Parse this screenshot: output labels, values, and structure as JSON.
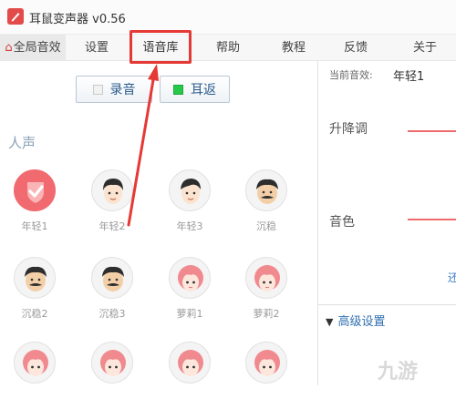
{
  "window": {
    "title": "耳鼠变声器 v0.56"
  },
  "tabs": [
    {
      "label": "全局音效",
      "icon": "lock-icon"
    },
    {
      "label": "设置"
    },
    {
      "label": "语音库",
      "highlighted": true
    },
    {
      "label": "帮助"
    },
    {
      "label": "教程"
    },
    {
      "label": "反馈"
    },
    {
      "label": "关于"
    }
  ],
  "toolbar": {
    "record_label": "录音",
    "monitor_label": "耳返",
    "monitor_active": true
  },
  "library": {
    "section_title": "人声",
    "voices": [
      {
        "name": "年轻1",
        "avatar": "check-badge-icon",
        "selected": true
      },
      {
        "name": "年轻2",
        "avatar": "young-man-face-icon"
      },
      {
        "name": "年轻3",
        "avatar": "young-man-face-icon"
      },
      {
        "name": "沉稳",
        "avatar": "mustache-man-face-icon"
      },
      {
        "name": "沉稳2",
        "avatar": "mustache-man-face-icon"
      },
      {
        "name": "沉稳3",
        "avatar": "mustache-man-face-icon"
      },
      {
        "name": "萝莉1",
        "avatar": "pink-hair-girl-face-icon"
      },
      {
        "name": "萝莉2",
        "avatar": "pink-hair-girl-face-icon"
      },
      {
        "avatar": "pink-hair-girl-face-icon"
      },
      {
        "avatar": "pink-hair-girl-face-icon"
      },
      {
        "avatar": "pink-hair-girl-face-icon"
      },
      {
        "avatar": "pink-hair-girl-face-icon"
      }
    ]
  },
  "right_panel": {
    "current_effect_label": "当前音效:",
    "current_effect_value": "年轻1",
    "pitch_label": "升降调",
    "timbre_label": "音色",
    "restore_link": "还",
    "advanced_settings_label": "高级设置"
  },
  "watermark": "九游",
  "colors": {
    "accent_red": "#e53935",
    "selected_avatar": "#f06a6f",
    "link_blue": "#2f6fb0",
    "monitor_green": "#27c94b"
  }
}
